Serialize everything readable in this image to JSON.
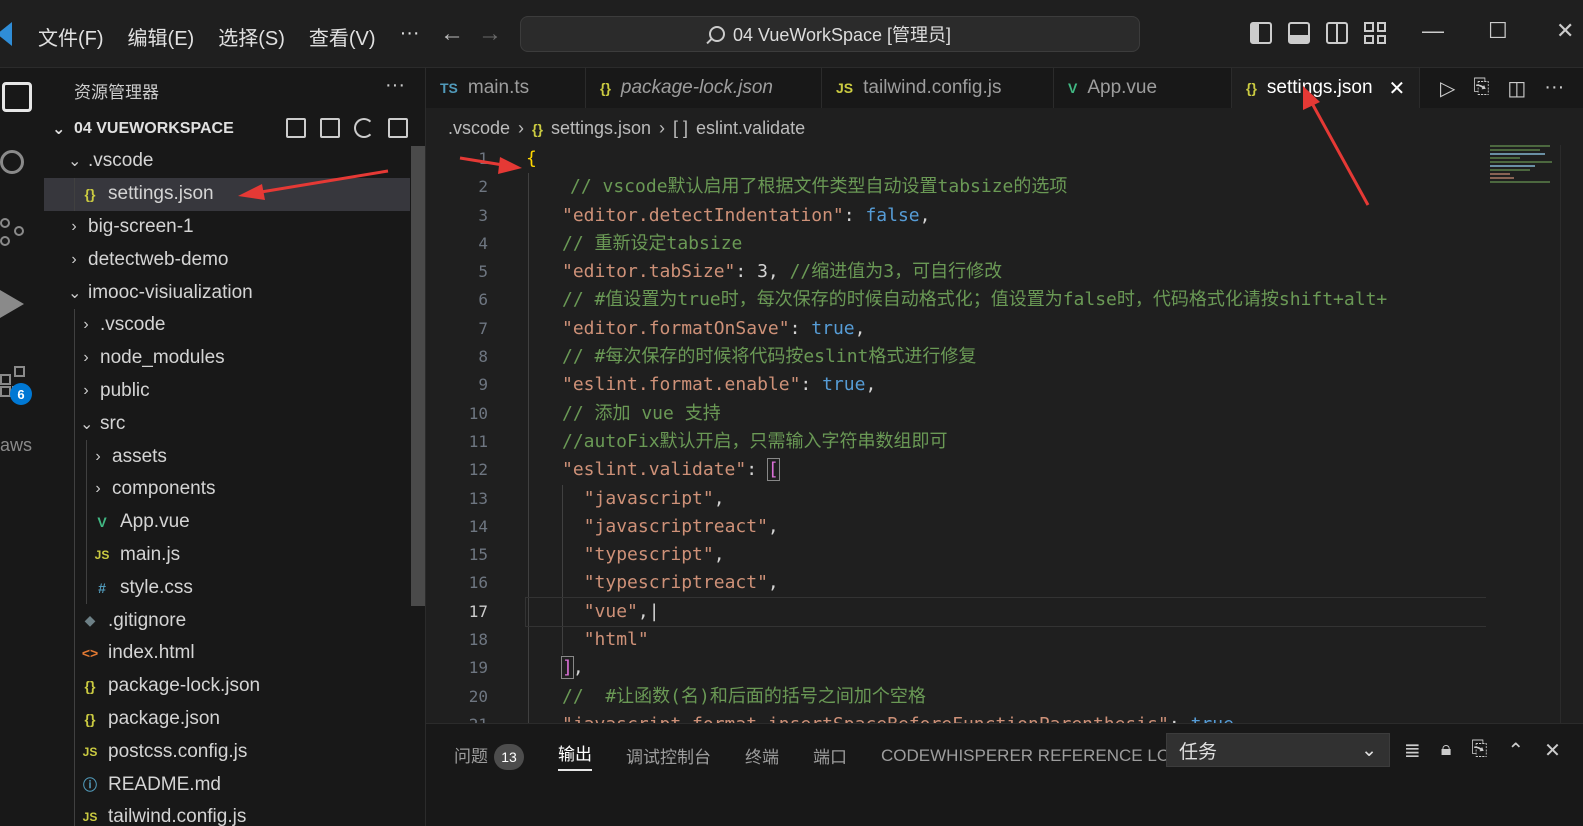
{
  "titlebar": {
    "menu": [
      "文件(F)",
      "编辑(E)",
      "选择(S)",
      "查看(V)",
      "···"
    ],
    "back_icon": "arrow-left-icon",
    "forward_icon": "arrow-right-icon",
    "command_center": "04 VueWorkSpace [管理员]",
    "window_controls": [
      "—",
      "☐",
      "✕"
    ]
  },
  "activity_bar": {
    "icons": [
      "files-icon",
      "search-icon",
      "source-control-icon",
      "run-debug-icon",
      "extensions-icon"
    ],
    "extensions_badge": "6",
    "aws_label": "aws"
  },
  "sidebar": {
    "title": "资源管理器",
    "more": "···",
    "workspace": "04 VUEWORKSPACE",
    "tree": [
      {
        "label": ".vscode",
        "type": "folder-open",
        "depth": 1
      },
      {
        "label": "settings.json",
        "type": "json",
        "depth": 2,
        "selected": true
      },
      {
        "label": "big-screen-1",
        "type": "folder",
        "depth": 1
      },
      {
        "label": "detectweb-demo",
        "type": "folder",
        "depth": 1
      },
      {
        "label": "imooc-visiualization",
        "type": "folder-open",
        "depth": 1
      },
      {
        "label": ".vscode",
        "type": "folder",
        "depth": 2
      },
      {
        "label": "node_modules",
        "type": "folder",
        "depth": 2
      },
      {
        "label": "public",
        "type": "folder",
        "depth": 2
      },
      {
        "label": "src",
        "type": "folder-open",
        "depth": 2
      },
      {
        "label": "assets",
        "type": "folder",
        "depth": 3
      },
      {
        "label": "components",
        "type": "folder",
        "depth": 3
      },
      {
        "label": "App.vue",
        "type": "vue",
        "depth": 3
      },
      {
        "label": "main.js",
        "type": "js",
        "depth": 3
      },
      {
        "label": "style.css",
        "type": "css",
        "depth": 3
      },
      {
        "label": ".gitignore",
        "type": "git",
        "depth": 2
      },
      {
        "label": "index.html",
        "type": "html",
        "depth": 2
      },
      {
        "label": "package-lock.json",
        "type": "json",
        "depth": 2
      },
      {
        "label": "package.json",
        "type": "json",
        "depth": 2
      },
      {
        "label": "postcss.config.js",
        "type": "js",
        "depth": 2
      },
      {
        "label": "README.md",
        "type": "info",
        "depth": 2
      },
      {
        "label": "tailwind.config.js",
        "type": "js",
        "depth": 2
      }
    ]
  },
  "tabs": [
    {
      "icon": "TS",
      "label": "main.ts",
      "italic": false,
      "active": false
    },
    {
      "icon": "{}",
      "label": "package-lock.json",
      "italic": true,
      "active": false
    },
    {
      "icon": "JS",
      "label": "tailwind.config.js",
      "italic": false,
      "active": false
    },
    {
      "icon": "V",
      "label": "App.vue",
      "italic": false,
      "active": false
    },
    {
      "icon": "{}",
      "label": "settings.json",
      "italic": false,
      "active": true
    }
  ],
  "breadcrumb": [
    ".vscode",
    "settings.json",
    "eslint.validate"
  ],
  "editor": {
    "current_line": 17,
    "lines": [
      [
        [
          "br",
          "{"
        ]
      ],
      [
        [
          "c",
          "// vscode默认启用了根据文件类型自动设置tabsize的选项"
        ]
      ],
      [
        [
          "s",
          "\"editor.detectIndentation\""
        ],
        [
          "p",
          ": "
        ],
        [
          "b",
          "false"
        ],
        [
          "p",
          ","
        ]
      ],
      [
        [
          "c",
          "// 重新设定tabsize"
        ]
      ],
      [
        [
          "s",
          "\"editor.tabSize\""
        ],
        [
          "p",
          ": 3, "
        ],
        [
          "c",
          "//缩进值为3，可自行修改"
        ]
      ],
      [
        [
          "c",
          "// #值设置为true时，每次保存的时候自动格式化；值设置为false时，代码格式化请按shift+alt+"
        ]
      ],
      [
        [
          "s",
          "\"editor.formatOnSave\""
        ],
        [
          "p",
          ": "
        ],
        [
          "b",
          "true"
        ],
        [
          "p",
          ","
        ]
      ],
      [
        [
          "c",
          "// #每次保存的时候将代码按eslint格式进行修复"
        ]
      ],
      [
        [
          "s",
          "\"eslint.format.enable\""
        ],
        [
          "p",
          ": "
        ],
        [
          "b",
          "true"
        ],
        [
          "p",
          ","
        ]
      ],
      [
        [
          "c",
          "// 添加 vue 支持"
        ]
      ],
      [
        [
          "c",
          "//autoFix默认开启，只需输入字符串数组即可"
        ]
      ],
      [
        [
          "s",
          "\"eslint.validate\""
        ],
        [
          "p",
          ": "
        ],
        [
          "br2",
          "["
        ]
      ],
      [
        [
          "p",
          "  "
        ],
        [
          "s",
          "\"javascript\""
        ],
        [
          "p",
          ","
        ]
      ],
      [
        [
          "p",
          "  "
        ],
        [
          "s",
          "\"javascriptreact\""
        ],
        [
          "p",
          ","
        ]
      ],
      [
        [
          "p",
          "  "
        ],
        [
          "s",
          "\"typescript\""
        ],
        [
          "p",
          ","
        ]
      ],
      [
        [
          "p",
          "  "
        ],
        [
          "s",
          "\"typescriptreact\""
        ],
        [
          "p",
          ","
        ]
      ],
      [
        [
          "p",
          "  "
        ],
        [
          "s",
          "\"vue\""
        ],
        [
          "p",
          ",|"
        ]
      ],
      [
        [
          "p",
          "  "
        ],
        [
          "s",
          "\"html\""
        ]
      ],
      [
        [
          "br2",
          "]"
        ],
        [
          "p",
          ","
        ]
      ],
      [
        [
          "c",
          "//  #让函数(名)和后面的括号之间加个空格"
        ]
      ],
      [
        [
          "s",
          "\"javascript.format.insertSpaceBeforeFunctionParenthesis\""
        ],
        [
          "p",
          ": "
        ],
        [
          "b",
          "true"
        ]
      ]
    ]
  },
  "panel": {
    "tabs": [
      "问题",
      "输出",
      "调试控制台",
      "终端",
      "端口",
      "CODEWHISPERER REFERENCE LOG"
    ],
    "problems_count": "13",
    "active_tab": "输出",
    "select_value": "任务"
  },
  "colors": {
    "accent": "#0078d4",
    "annotation_arrow": "#e53935",
    "json_icon": "#cbcb41",
    "vue_icon": "#41b883"
  }
}
